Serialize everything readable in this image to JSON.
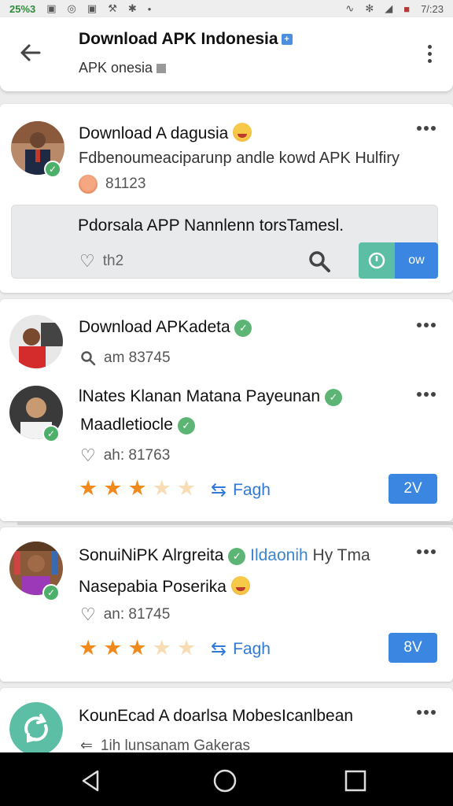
{
  "status_bar": {
    "left_text": "25%3",
    "time": "7/:23"
  },
  "app_bar": {
    "title": "Download APK Indonesia",
    "subtitle": "APK onesia"
  },
  "post1": {
    "name": "Download A dagusia",
    "description": "Fdbenoumeaciparunp andle kowd APK Hulfiry",
    "count": "81123",
    "inner_text": "Pdorsala APP Nannlenn torsTamesl.",
    "likes": "th2",
    "action_label": "ow"
  },
  "post2": {
    "name": "Download APKadeta",
    "meta": "am 83745"
  },
  "post3": {
    "name_line1": "lNates Klanan Matana Payeunan",
    "name_line2": "Maadletiocle",
    "likes": "ah: 81763",
    "rating": 3,
    "share_label": "Fagh",
    "pill_label": "2V"
  },
  "post4": {
    "name": "SonuiNiPK Alrgreita",
    "name_link": "Ildaonih",
    "name_tail": "Hy Tma",
    "name_line2": "Nasepabia Poserika",
    "likes": "an: 81745",
    "rating": 3,
    "share_label": "Fagh",
    "pill_label": "8V"
  },
  "post5": {
    "name": "KounEcad A doarlsa MobesIcanlbean",
    "meta": "1ih lunsanam Gakeras"
  },
  "colors": {
    "accent_blue": "#3a86e0",
    "verified_green": "#4caf6a",
    "star_orange": "#f08a1c",
    "teal": "#5cbfa5"
  }
}
